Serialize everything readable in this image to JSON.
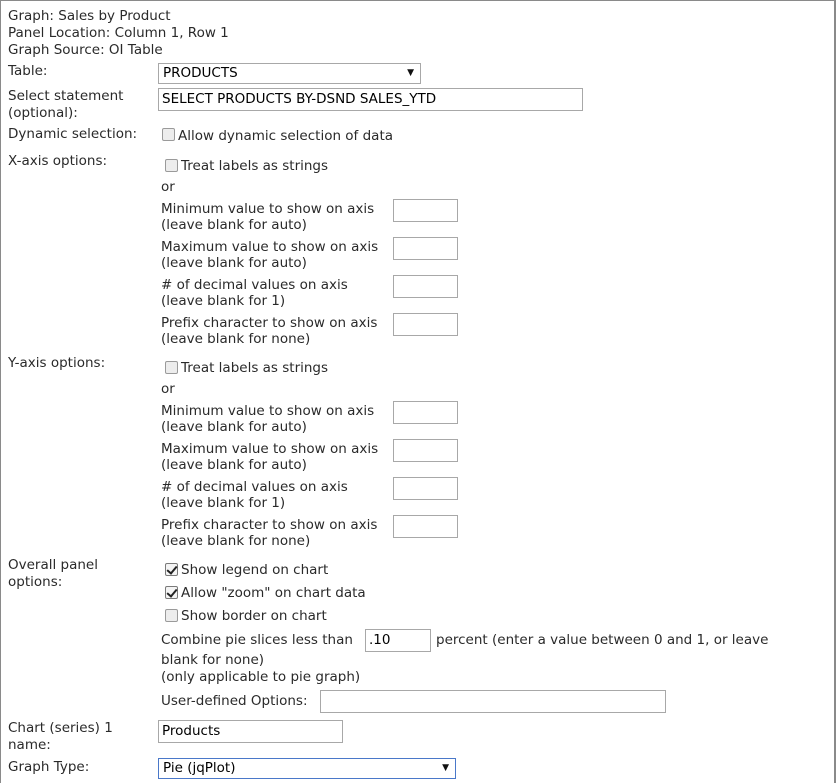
{
  "header": {
    "graph": "Graph: Sales by Product",
    "panel_location": "Panel Location: Column 1, Row 1",
    "graph_source": "Graph Source: OI Table"
  },
  "table": {
    "label": "Table:",
    "value": "PRODUCTS"
  },
  "select_statement": {
    "label_line1": "Select statement",
    "label_line2": "(optional):",
    "value": "SELECT PRODUCTS BY-DSND SALES_YTD"
  },
  "dynamic_selection": {
    "label": "Dynamic selection:",
    "checkbox_label": "Allow dynamic selection of data",
    "checked": false
  },
  "x_axis": {
    "label": "X-axis options:",
    "strings_label": "Treat labels as strings",
    "or": "or",
    "min": {
      "line1": "Minimum value to show on axis",
      "line2": "(leave blank for auto)",
      "value": ""
    },
    "max": {
      "line1": "Maximum value to show on axis",
      "line2": "(leave blank for auto)",
      "value": ""
    },
    "decimals": {
      "line1": "# of decimal values on axis",
      "line2": "(leave blank for 1)",
      "value": ""
    },
    "prefix": {
      "line1": "Prefix character to show on axis",
      "line2": "(leave blank for none)",
      "value": ""
    }
  },
  "y_axis": {
    "label": "Y-axis options:",
    "strings_label": "Treat labels as strings",
    "or": "or",
    "min": {
      "line1": "Minimum value to show on axis",
      "line2": "(leave blank for auto)",
      "value": ""
    },
    "max": {
      "line1": "Maximum value to show on axis",
      "line2": "(leave blank for auto)",
      "value": ""
    },
    "decimals": {
      "line1": "# of decimal values on axis",
      "line2": "(leave blank for 1)",
      "value": ""
    },
    "prefix": {
      "line1": "Prefix character to show on axis",
      "line2": "(leave blank for none)",
      "value": ""
    }
  },
  "overall": {
    "label_line1": "Overall panel",
    "label_line2": "options:",
    "show_legend": "Show legend on chart",
    "allow_zoom": "Allow \"zoom\" on chart data",
    "show_border": "Show border on chart",
    "combine_prefix": "Combine pie slices less than",
    "combine_value": ".10",
    "combine_suffix": "percent (enter a value between 0 and 1, or leave",
    "combine_line2": "blank for none)",
    "combine_line3": "(only applicable to pie graph)",
    "user_defined_label": "User-defined Options:",
    "user_defined_value": ""
  },
  "series": {
    "label_line1": "Chart (series) 1",
    "label_line2": "name:",
    "value": "Products"
  },
  "graph_type": {
    "label": "Graph Type:",
    "value": "Pie (jqPlot)"
  },
  "icons": {
    "dropdown": "chevron-down-icon",
    "checkmark": "checkmark-icon"
  }
}
